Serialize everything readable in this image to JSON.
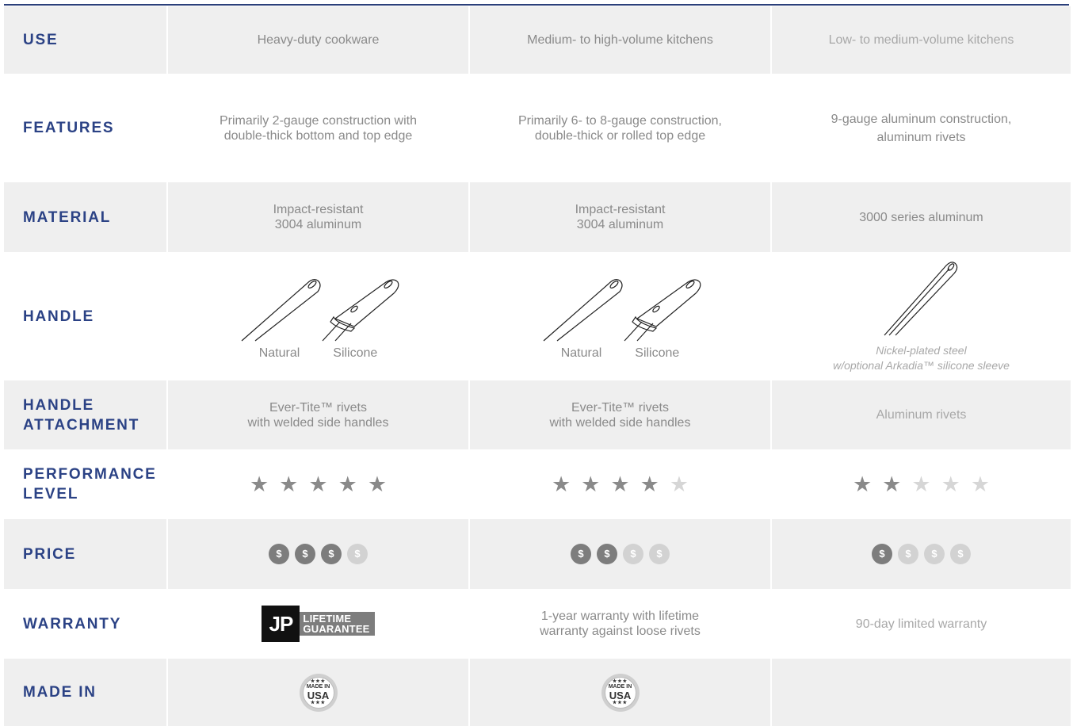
{
  "columns": 3,
  "rows": {
    "use": {
      "label": "USE",
      "values": [
        "Heavy-duty cookware",
        "Medium- to high-volume kitchens",
        "Low- to medium-volume kitchens"
      ]
    },
    "features": {
      "label": "FEATURES",
      "values": [
        [
          "Primarily 2-gauge construction with",
          "double-thick bottom and top edge"
        ],
        [
          "Primarily 6- to 8-gauge construction,",
          "double-thick or rolled top edge"
        ],
        [
          "9-gauge aluminum construction,",
          "aluminum rivets"
        ]
      ]
    },
    "material": {
      "label": "MATERIAL",
      "values": [
        [
          "Impact-resistant",
          "3004 aluminum"
        ],
        [
          "Impact-resistant",
          "3004 aluminum"
        ],
        [
          "3000 series aluminum"
        ]
      ]
    },
    "handle": {
      "label": "HANDLE",
      "col1": {
        "natural": "Natural",
        "silicone": "Silicone"
      },
      "col2": {
        "natural": "Natural",
        "silicone": "Silicone"
      },
      "col3": [
        "Nickel-plated steel",
        "w/optional Arkadia™ silicone sleeve"
      ]
    },
    "handle_attachment": {
      "label_line1": "HANDLE",
      "label_line2": "ATTACHMENT",
      "values": [
        [
          "Ever-Tite™ rivets",
          "with welded side handles"
        ],
        [
          "Ever-Tite™ rivets",
          "with welded side handles"
        ],
        [
          "Aluminum rivets"
        ]
      ]
    },
    "performance": {
      "label_line1": "PERFORMANCE",
      "label_line2": "LEVEL",
      "rating_max": 5,
      "ratings": [
        5,
        4,
        2
      ],
      "star_glyph": "★"
    },
    "price": {
      "label": "PRICE",
      "coin_glyph": "$",
      "levels": [
        3,
        2,
        1
      ],
      "max_levels": [
        4,
        4,
        4
      ]
    },
    "warranty": {
      "label": "WARRANTY",
      "badge": {
        "mark": "JP",
        "line1": "LIFETIME",
        "line2": "GUARANTEE"
      },
      "values": [
        "",
        [
          "1-year warranty with lifetime",
          "warranty against loose rivets"
        ],
        "90-day limited warranty"
      ]
    },
    "made_in": {
      "label": "MADE IN",
      "badge": {
        "stars": "★★★",
        "line1": "MADE IN",
        "line2": "USA"
      },
      "present": [
        true,
        true,
        false
      ]
    }
  },
  "colors": {
    "header_text": "#2b4285",
    "top_rule": "#2a3f7a",
    "row_shade": "#efefef",
    "body_text": "#8a8a8a",
    "active_icon": "#7d7d7d",
    "inactive_icon": "#d2d2d2"
  },
  "icons": [
    "natural-handle-icon",
    "silicone-handle-icon",
    "nickel-handle-icon",
    "star-icon",
    "dollar-coin-icon",
    "lifetime-guarantee-badge",
    "made-in-usa-badge"
  ]
}
